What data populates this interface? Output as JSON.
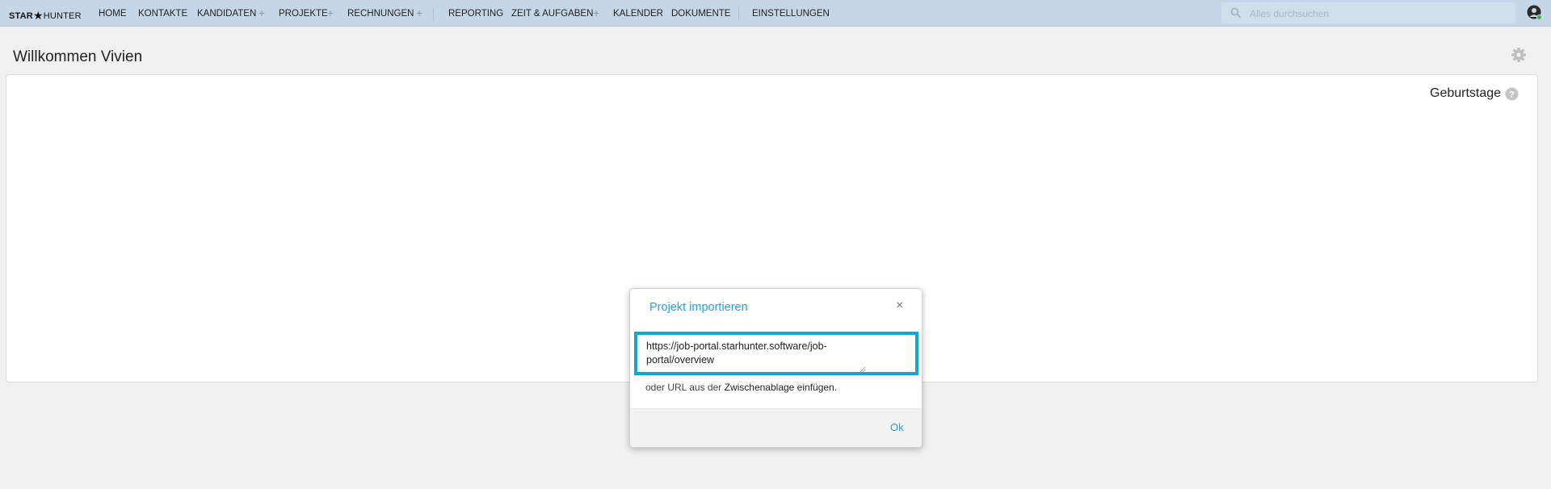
{
  "app": {
    "logo_left": "STAR",
    "logo_right": "HUNTER",
    "colors": {
      "topbar": "#c5d7e6",
      "accent": "#2a9fd0",
      "highlight_border": "#14a6c7"
    }
  },
  "nav": {
    "items": [
      {
        "label": "HOME"
      },
      {
        "label": "KONTAKTE"
      },
      {
        "label": "KANDIDATEN",
        "plus": "+"
      },
      {
        "label": "PROJEKTE",
        "plus": "+"
      },
      {
        "label": "RECHNUNGEN",
        "plus": "+"
      },
      {
        "label": "REPORTING"
      },
      {
        "label": "ZEIT & AUFGABEN",
        "plus": "+"
      },
      {
        "label": "KALENDER"
      },
      {
        "label": "DOKUMENTE"
      },
      {
        "label": "EINSTELLUNGEN"
      }
    ]
  },
  "search": {
    "placeholder": "Alles durchsuchen",
    "icon": "search-icon"
  },
  "page": {
    "title": "Willkommen Vivien",
    "widget_title": "Geburtstage"
  },
  "modal": {
    "title": "Projekt importieren",
    "close_label": "×",
    "url_value": "https://job-portal.starhunter.software/job-portal/overview",
    "hint_prefix": "oder URL aus der",
    "hint_link": "Zwischenablage einfügen.",
    "ok_label": "Ok"
  }
}
